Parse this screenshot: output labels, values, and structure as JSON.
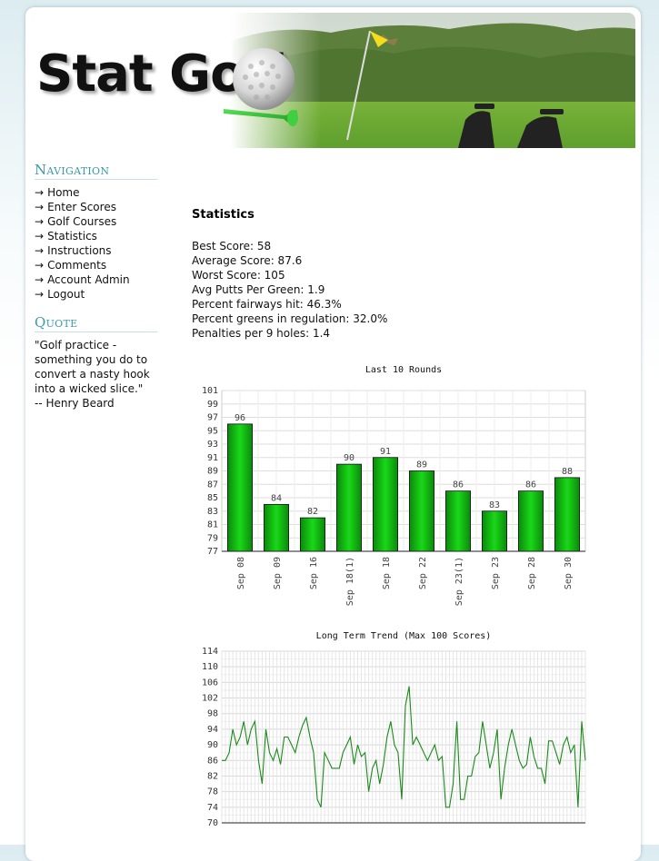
{
  "header": {
    "logo_text": "Stat Golf"
  },
  "navigation": {
    "title": "Navigation",
    "items": [
      {
        "label": "Home"
      },
      {
        "label": "Enter Scores"
      },
      {
        "label": "Golf Courses"
      },
      {
        "label": "Statistics"
      },
      {
        "label": "Instructions"
      },
      {
        "label": "Comments"
      },
      {
        "label": "Account Admin"
      },
      {
        "label": "Logout"
      }
    ]
  },
  "quote": {
    "title": "Quote",
    "lines": [
      "\"Golf practice -",
      "something you do to",
      "convert a nasty hook",
      "into a wicked slice.\"",
      "-- Henry Beard"
    ]
  },
  "statistics": {
    "title": "Statistics",
    "items": [
      "Best Score: 58",
      "Average Score: 87.6",
      "Worst Score: 105",
      "Avg Putts Per Green: 1.9",
      "Percent fairways hit: 46.3%",
      "Percent greens in regulation: 32.0%",
      "Penalties per 9 holes: 1.4"
    ]
  },
  "colors": {
    "accent": "#3a9aa6",
    "bar": "#11c411",
    "line": "#1a8a1a"
  },
  "chart_data": [
    {
      "type": "bar",
      "title": "Last 10 Rounds",
      "categories": [
        "Sep 08",
        "Sep 09",
        "Sep 16",
        "Sep 18(1)",
        "Sep 18",
        "Sep 22",
        "Sep 23(1)",
        "Sep 23",
        "Sep 28",
        "Sep 30"
      ],
      "values": [
        96,
        84,
        82,
        90,
        91,
        89,
        86,
        83,
        86,
        88
      ],
      "ylim": [
        77,
        101
      ],
      "yticks": [
        77,
        79,
        81,
        83,
        85,
        87,
        89,
        91,
        93,
        95,
        97,
        99,
        101
      ],
      "grid": true
    },
    {
      "type": "line",
      "title": "Long Term Trend (Max 100 Scores)",
      "ylim": [
        70,
        114
      ],
      "yticks": [
        70,
        74,
        78,
        82,
        86,
        90,
        94,
        98,
        102,
        106,
        110,
        114
      ],
      "grid": true,
      "values": [
        86,
        86,
        88,
        94,
        90,
        92,
        96,
        90,
        94,
        96,
        86,
        80,
        94,
        88,
        86,
        89,
        85,
        92,
        92,
        90,
        88,
        92,
        95,
        97,
        92,
        88,
        76,
        74,
        88,
        86,
        84,
        84,
        84,
        88,
        90,
        92,
        85,
        90,
        87,
        88,
        78,
        84,
        86,
        80,
        85,
        92,
        96,
        90,
        88,
        76,
        100,
        105,
        90,
        92,
        90,
        88,
        86,
        88,
        90,
        86,
        87,
        74,
        74,
        80,
        96,
        76,
        76,
        82,
        82,
        87,
        88,
        96,
        90,
        84,
        88,
        94,
        76,
        84,
        90,
        94,
        90,
        86,
        84,
        85,
        92,
        87,
        84,
        84,
        80,
        91,
        91,
        88,
        85,
        90,
        92,
        88,
        90,
        74,
        96,
        86
      ]
    }
  ]
}
